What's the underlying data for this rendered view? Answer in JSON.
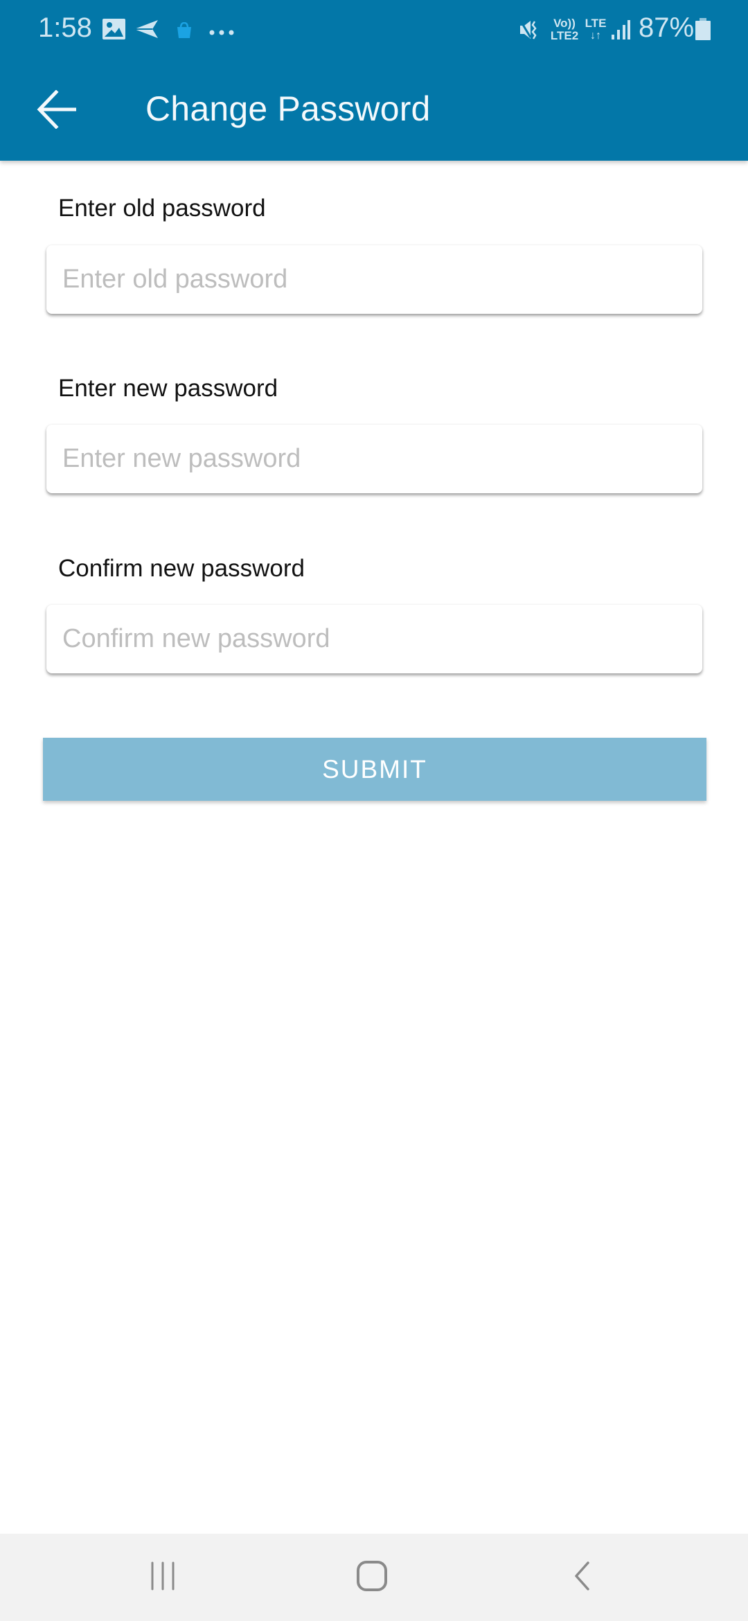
{
  "status_bar": {
    "time": "1:58",
    "left_icons": [
      "gallery-icon",
      "send-icon",
      "shopping-bag-icon",
      "more-dots-icon"
    ],
    "right_icons": [
      "vibrate-mute-icon",
      "volte-lte2-icon",
      "lte-data-icon",
      "signal-icon",
      "battery-icon"
    ],
    "volte_top": "Vo))",
    "volte_bottom": "LTE2",
    "lte_label": "LTE",
    "battery_percent": "87%"
  },
  "app_bar": {
    "title": "Change Password",
    "back_icon": "arrow-left-icon",
    "color": "#0377a8"
  },
  "form": {
    "fields": [
      {
        "label": "Enter old password",
        "placeholder": "Enter old password",
        "value": ""
      },
      {
        "label": "Enter new password",
        "placeholder": "Enter new password",
        "value": ""
      },
      {
        "label": "Confirm new password",
        "placeholder": "Confirm new password",
        "value": ""
      }
    ],
    "submit_label": "SUBMIT",
    "submit_color": "#81bad4"
  },
  "nav_bar": {
    "buttons": [
      "recent-apps-icon",
      "home-icon",
      "back-icon"
    ]
  }
}
